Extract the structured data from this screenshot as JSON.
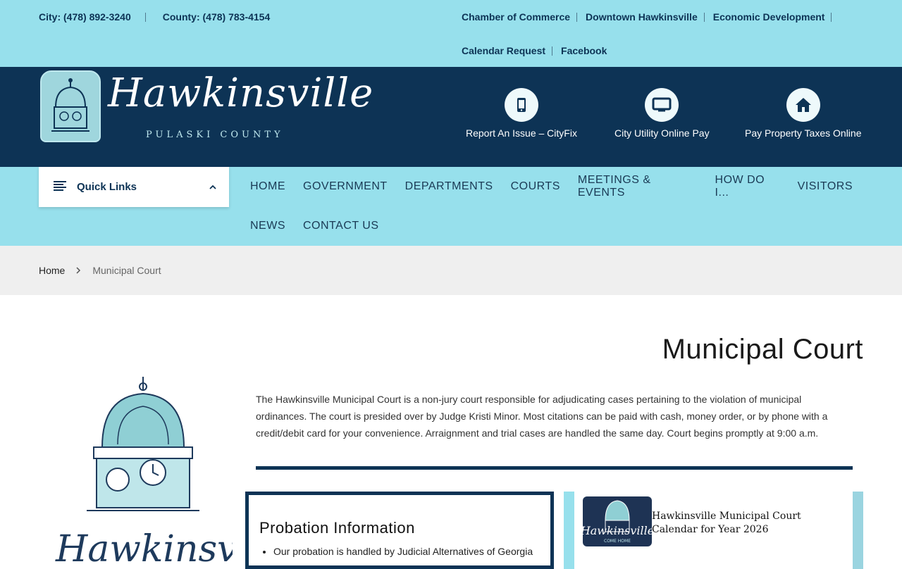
{
  "topbar": {
    "city_phone": "City: (478) 892-3240",
    "county_phone": "County: (478) 783-4154",
    "links_row1": [
      "Chamber of Commerce",
      "Downtown Hawkinsville",
      "Economic Development"
    ],
    "links_row2": [
      "Calendar Request",
      "Facebook"
    ]
  },
  "header": {
    "logo_script": "Hawkinsville",
    "logo_sub": "PULASKI COUNTY",
    "quick": [
      {
        "label": "Report An Issue – CityFix",
        "icon": "phone-icon"
      },
      {
        "label": "City Utility Online Pay",
        "icon": "monitor-icon"
      },
      {
        "label": "Pay Property Taxes Online",
        "icon": "home-icon"
      }
    ]
  },
  "nav": {
    "quick_links": "Quick Links",
    "row1": [
      "HOME",
      "GOVERNMENT",
      "DEPARTMENTS",
      "COURTS",
      "MEETINGS & EVENTS",
      "HOW DO I...",
      "VISITORS"
    ],
    "row2": [
      "NEWS",
      "CONTACT US"
    ]
  },
  "breadcrumb": {
    "home": "Home",
    "current": "Municipal Court"
  },
  "main": {
    "title": "Municipal Court",
    "sidelogo_text": "Hawkinsville",
    "intro": "The Hawkinsville Municipal Court is a non-jury court responsible for adjudicating cases pertaining to the violation of municipal ordinances. The court is presided over by Judge Kristi Minor. Most citations can be paid with cash, money order, or by phone with a credit/debit card for your convenience. Arraignment and trial cases are handled the same day. Court begins promptly at 9:00 a.m.",
    "probation_title": "Probation Information",
    "probation_item": "Our probation is handled by Judicial Alternatives of Georgia",
    "calendar_line1": "Hawkinsville Municipal Court",
    "calendar_line2": "Calendar for Year 2026",
    "thumb_script": "Hawkinsville",
    "thumb_sub": "COME HOME"
  },
  "colors": {
    "navy": "#0d3355",
    "light_blue": "#97e0ec"
  }
}
